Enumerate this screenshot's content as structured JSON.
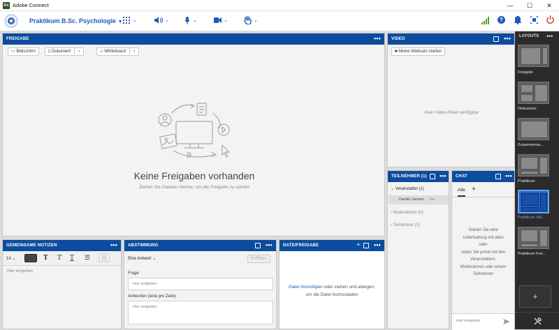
{
  "window": {
    "title": "Adobe Connect",
    "app_icon_text": "Ac",
    "minimize": "—",
    "maximize": "☐",
    "close": "✕"
  },
  "toolbar": {
    "meeting_name": "Praktikum B.Sc. Psychologie"
  },
  "share_pod": {
    "header": "FREIGABE",
    "btn_screen": "Bildschirm",
    "btn_document": "Dokument",
    "btn_whiteboard": "Whiteboard",
    "empty_title": "Keine Freigaben vorhanden",
    "empty_hint": "Ziehen Sie Dateien hierher, um die Freigabe zu starten"
  },
  "video_pod": {
    "header": "VIDEO",
    "start_webcam": "Meine Webcam starten",
    "no_feed": "Kein Video-Feed verfügbar"
  },
  "attendees_pod": {
    "header": "TEILNEHMER",
    "count": "(1)",
    "hosts": "Veranstalter (1)",
    "host_name": "Carolin Jansen",
    "host_you": "Sie",
    "presenters": "Moderatoren (0)",
    "participants": "Teilnehmer (0)"
  },
  "chat_pod": {
    "header": "CHAT",
    "tab_all": "Alle",
    "add_tab": "+",
    "empty_lines": [
      "Starten Sie eine",
      "Unterhaltung mit allen",
      "oder",
      "reden Sie privat mit den",
      "Veranstaltern,",
      "Moderatoren oder einem",
      "Teilnehmer"
    ],
    "input_placeholder": "Hier eingeben"
  },
  "notes_pod": {
    "header": "GEMEINSAME NOTIZEN",
    "font_size": "14",
    "placeholder": "Hier eingeben"
  },
  "poll_pod": {
    "header": "ABSTIMMUNG",
    "type": "Eine Antwort",
    "open_btn": "Eröffnen",
    "question_label": "Frage",
    "question_placeholder": "Hier eingeben",
    "answers_label": "Antworten (eine pro Zeile)",
    "answers_placeholder": "Hier eingeben"
  },
  "files_pod": {
    "header": "DATEIFREIGABE",
    "add_link": "Datei hinzufügen",
    "hint_rest": " oder ziehen und ablegen,",
    "hint_line2": "um die Datei hochzuladen"
  },
  "layouts": {
    "header": "LAYOUTS",
    "items": [
      "Freigabe",
      "Diskussion",
      "Zusammenar...",
      "Praktikum",
      "Praktikum Vid...",
      "Praktikum Frei..."
    ],
    "add": "+"
  },
  "colors": {
    "accent": "#0c4c9e",
    "selected_layout": "#2464c7",
    "brand_icon": "#1f5bb8"
  }
}
